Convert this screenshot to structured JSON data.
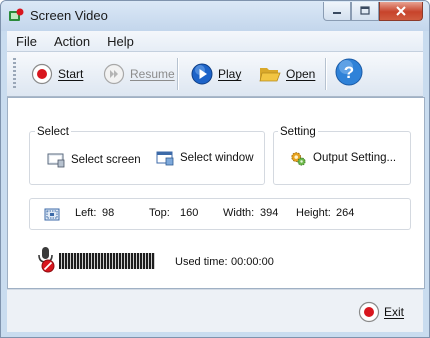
{
  "window": {
    "title": "Screen Video",
    "controls": {
      "minimize": "minimize-icon",
      "maximize": "maximize-icon",
      "close": "close-icon"
    }
  },
  "menu": {
    "file": "File",
    "action": "Action",
    "help": "Help"
  },
  "toolbar": {
    "start": "Start",
    "resume": "Resume",
    "resume_enabled": false,
    "play": "Play",
    "open": "Open"
  },
  "select_group": {
    "title": "Select",
    "screen": "Select screen",
    "window": "Select window"
  },
  "setting_group": {
    "title": "Setting",
    "output": "Output Setting..."
  },
  "region": {
    "left_label": "Left:",
    "left": "98",
    "top_label": "Top:",
    "top": "160",
    "width_label": "Width:",
    "width": "394",
    "height_label": "Height:",
    "height": "264"
  },
  "recording": {
    "used_time_label": "Used time:",
    "used_time": "00:00:00"
  },
  "footer": {
    "exit": "Exit"
  },
  "colors": {
    "record_red": "#d8161e",
    "window_frame": "#c9dcef",
    "play_blue": "#1d63c8",
    "help_blue": "#2f82d8",
    "folder_yellow": "#f2c542"
  }
}
